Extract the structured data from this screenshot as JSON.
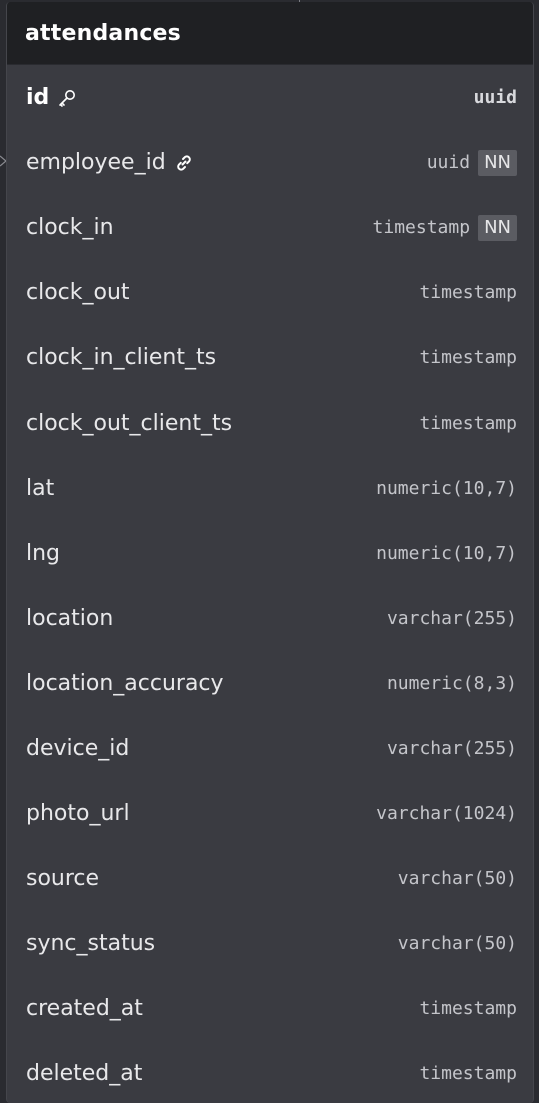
{
  "table": {
    "title": "attendances",
    "columns": [
      {
        "name": "id",
        "type": "uuid",
        "primary_key": true,
        "icon": "key-icon",
        "nn": ""
      },
      {
        "name": "employee_id",
        "type": "uuid",
        "icon": "link-icon",
        "nn": "NN"
      },
      {
        "name": "clock_in",
        "type": "timestamp",
        "nn": "NN"
      },
      {
        "name": "clock_out",
        "type": "timestamp",
        "nn": ""
      },
      {
        "name": "clock_in_client_ts",
        "type": "timestamp",
        "nn": ""
      },
      {
        "name": "clock_out_client_ts",
        "type": "timestamp",
        "nn": ""
      },
      {
        "name": "lat",
        "type": "numeric(10,7)",
        "nn": ""
      },
      {
        "name": "lng",
        "type": "numeric(10,7)",
        "nn": ""
      },
      {
        "name": "location",
        "type": "varchar(255)",
        "nn": ""
      },
      {
        "name": "location_accuracy",
        "type": "numeric(8,3)",
        "nn": ""
      },
      {
        "name": "device_id",
        "type": "varchar(255)",
        "nn": ""
      },
      {
        "name": "photo_url",
        "type": "varchar(1024)",
        "nn": ""
      },
      {
        "name": "source",
        "type": "varchar(50)",
        "nn": ""
      },
      {
        "name": "sync_status",
        "type": "varchar(50)",
        "nn": ""
      },
      {
        "name": "created_at",
        "type": "timestamp",
        "nn": ""
      },
      {
        "name": "deleted_at",
        "type": "timestamp",
        "nn": ""
      }
    ]
  },
  "colors": {
    "header_bg": "#1f2023",
    "body_bg": "#3a3b41",
    "canvas_bg": "#2a2b30",
    "badge_bg": "#5b5c62"
  }
}
